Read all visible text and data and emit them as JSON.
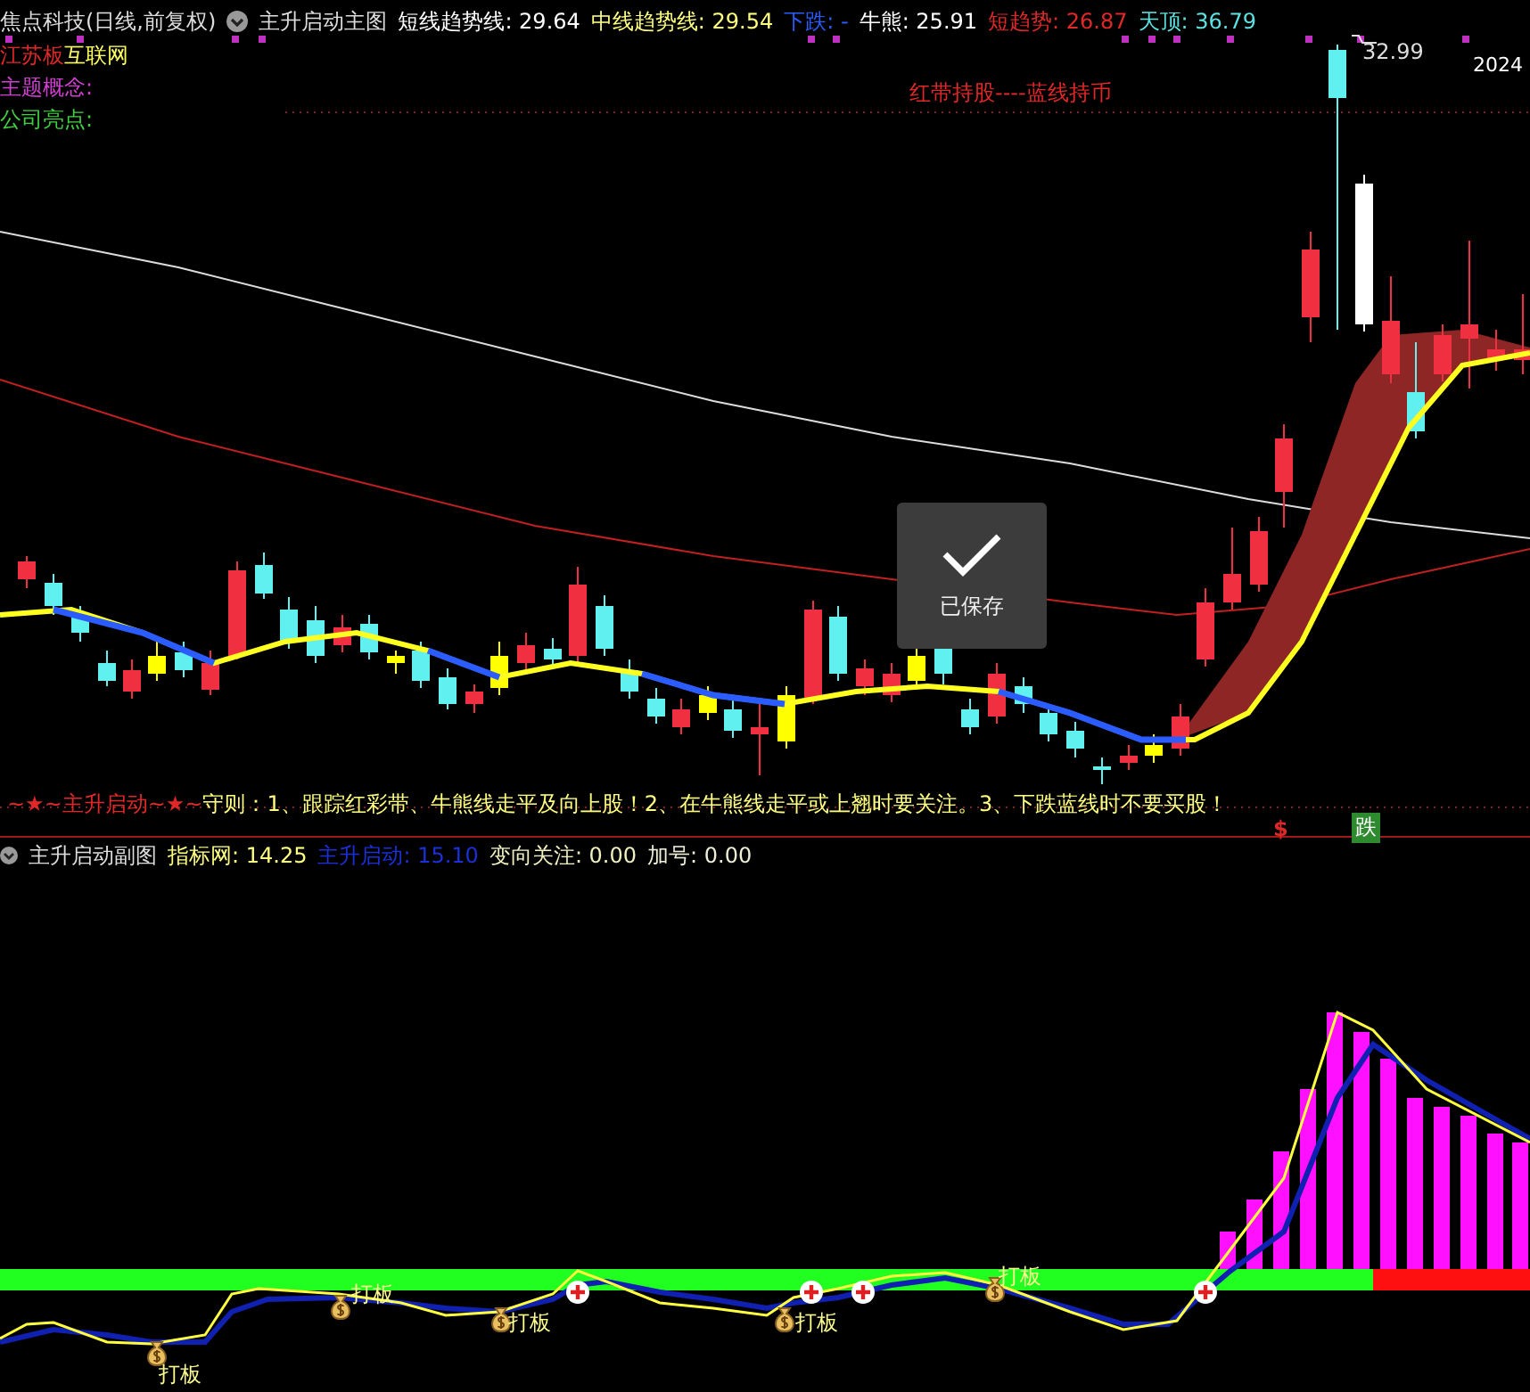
{
  "main_chart": {
    "security": "焦点科技(日线,前复权)",
    "indicator": "主升启动主图",
    "readings": [
      {
        "text": "短线趋势线: 29.64",
        "color": "#ffffff"
      },
      {
        "text": "中线趋势线: 29.54",
        "color": "#ffff80"
      },
      {
        "text": "下跌: -",
        "color": "#2a5cff"
      },
      {
        "text": "牛熊: 25.91",
        "color": "#ffffff"
      },
      {
        "text": "短趋势: 26.87",
        "color": "#e02828"
      },
      {
        "text": "天顶: 36.79",
        "color": "#5ee0e0"
      }
    ],
    "info_rows": [
      {
        "items": [
          {
            "text": "江苏板",
            "color": "#e02828"
          },
          {
            "text": "互联网",
            "color": "#ffff60"
          }
        ]
      },
      {
        "items": [
          {
            "text": "主题概念:",
            "color": "#d040d0"
          }
        ]
      },
      {
        "items": [
          {
            "text": "公司亮点:",
            "color": "#40d040"
          }
        ]
      }
    ],
    "strategy_note": "红带持股----蓝线持币",
    "price_label": "32.99",
    "date_label": "2024",
    "toast": {
      "text": "已保存"
    },
    "rule": {
      "tag": "~★~主升启动~★~",
      "text": "守则：1、跟踪红彩带、牛熊线走平及向上股！2、在牛熊线走平或上翘时要关注。3、下跌蓝线时不要买股！"
    },
    "signals": [
      {
        "text": "$",
        "kind": "mark",
        "color": "#e02828"
      },
      {
        "text": "跌",
        "kind": "badge",
        "color": "#2e8a2e"
      }
    ]
  },
  "sub_chart": {
    "indicator": "主升启动副图",
    "readings": [
      {
        "text": "指标网: 14.25",
        "color": "#ffff80"
      },
      {
        "text": "主升启动: 15.10",
        "color": "#1a30d8"
      },
      {
        "text": "变向关注: 0.00",
        "color": "#f0f0c0"
      },
      {
        "text": "加号: 0.00",
        "color": "#f0f0d8"
      }
    ],
    "signal_labels": [
      "打板",
      "打板",
      "打板",
      "打板",
      "打板"
    ]
  }
}
